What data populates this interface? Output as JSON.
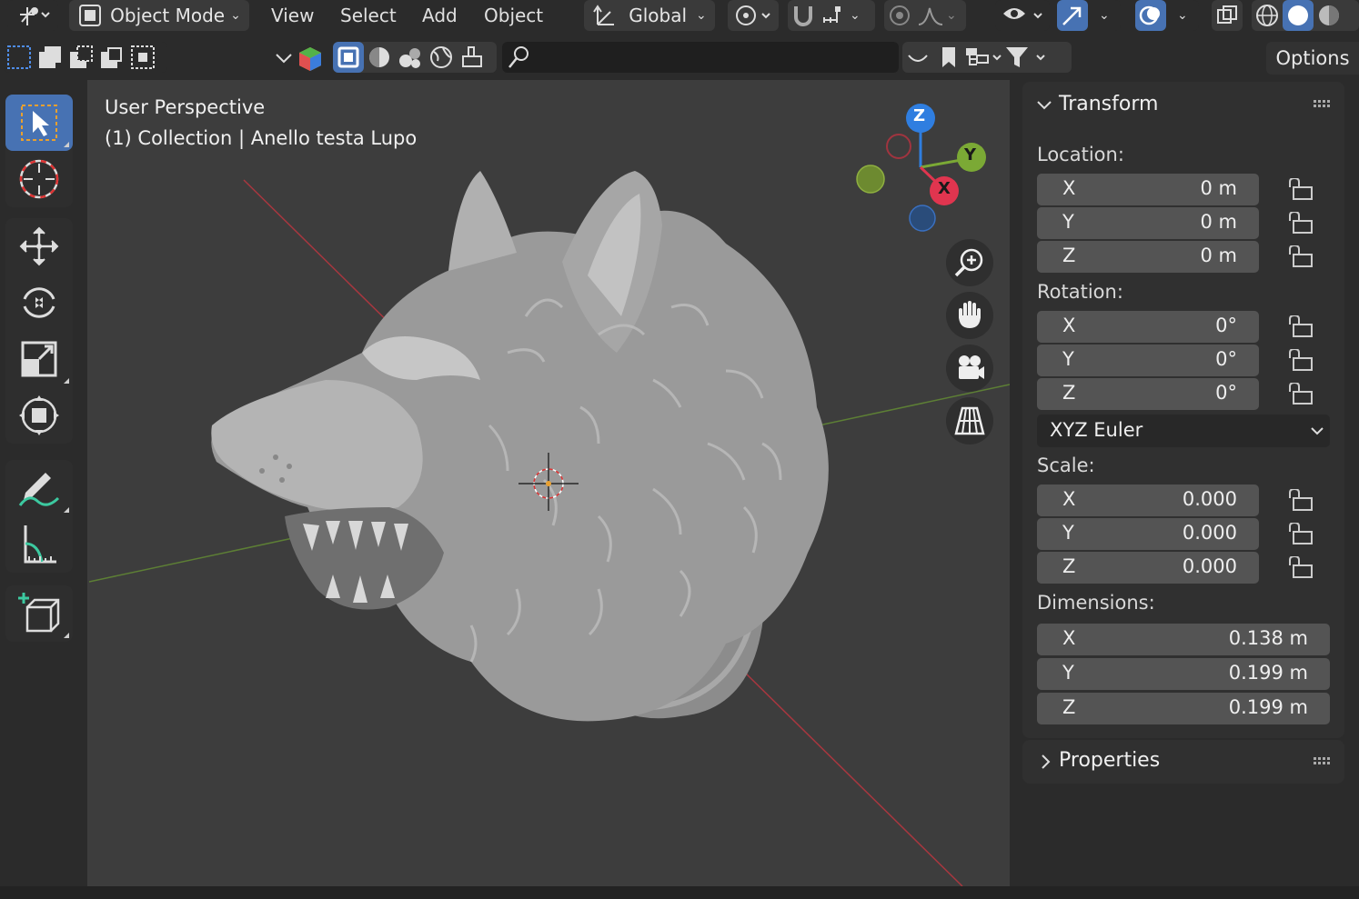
{
  "header": {
    "mode_label": "Object Mode",
    "menu": [
      "View",
      "Select",
      "Add",
      "Object"
    ],
    "transform_orientation": "Global",
    "options_label": "Options",
    "search_placeholder": ""
  },
  "viewport": {
    "view_name": "User Perspective",
    "collection_info": "(1) Collection | Anello testa Lupo",
    "gizmo": {
      "z": "Z",
      "y": "Y",
      "x": "X"
    },
    "colors": {
      "x_axis": "#e0354f",
      "y_axis": "#7ba935",
      "z_axis": "#2f7ee0",
      "bg": "#3d3d3d"
    }
  },
  "toolbar": {
    "tools": [
      "select-box",
      "cursor",
      "move",
      "rotate",
      "scale",
      "transform",
      "annotate",
      "measure",
      "add-cube"
    ],
    "active_tool": "select-box"
  },
  "npanel": {
    "transform_title": "Transform",
    "location_label": "Location:",
    "location": [
      {
        "axis": "X",
        "value": "0 m"
      },
      {
        "axis": "Y",
        "value": "0 m"
      },
      {
        "axis": "Z",
        "value": "0 m"
      }
    ],
    "rotation_label": "Rotation:",
    "rotation": [
      {
        "axis": "X",
        "value": "0°"
      },
      {
        "axis": "Y",
        "value": "0°"
      },
      {
        "axis": "Z",
        "value": "0°"
      }
    ],
    "rotation_mode": "XYZ Euler",
    "scale_label": "Scale:",
    "scale": [
      {
        "axis": "X",
        "value": "0.000"
      },
      {
        "axis": "Y",
        "value": "0.000"
      },
      {
        "axis": "Z",
        "value": "0.000"
      }
    ],
    "dimensions_label": "Dimensions:",
    "dimensions": [
      {
        "axis": "X",
        "value": "0.138 m"
      },
      {
        "axis": "Y",
        "value": "0.199 m"
      },
      {
        "axis": "Z",
        "value": "0.199 m"
      }
    ],
    "properties_title": "Properties"
  }
}
